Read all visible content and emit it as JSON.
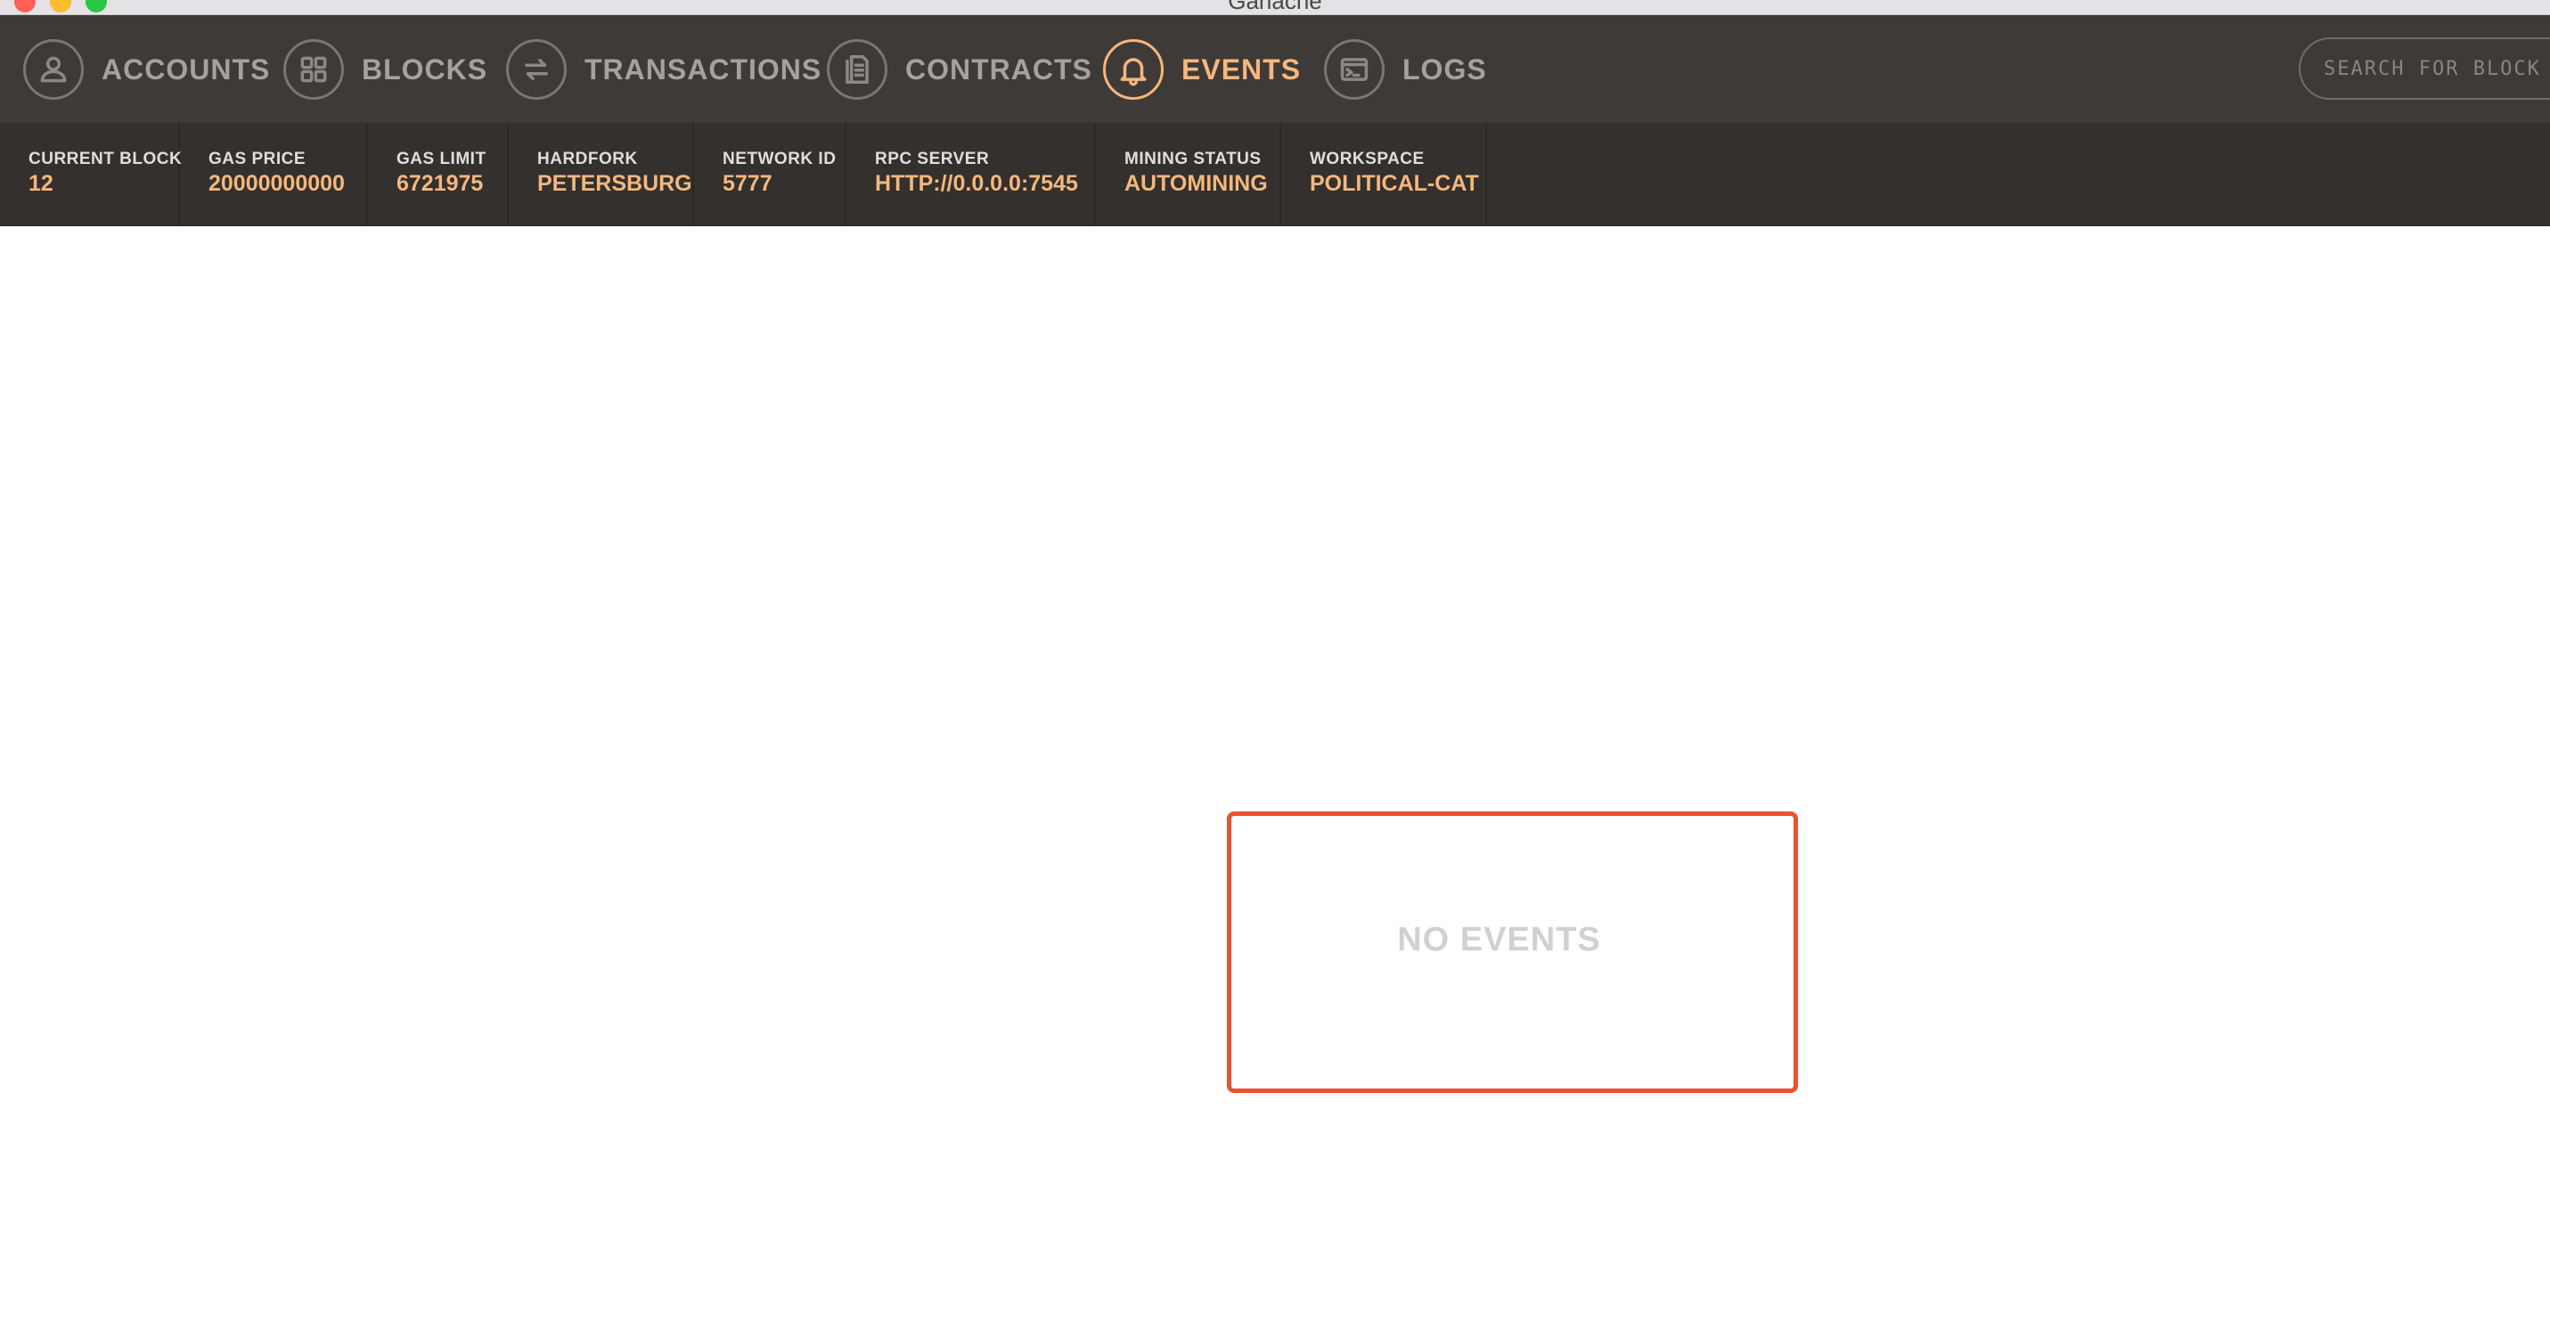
{
  "window": {
    "title": "Ganache"
  },
  "nav": {
    "items": [
      {
        "label": "ACCOUNTS",
        "icon": "user-icon",
        "active": false
      },
      {
        "label": "BLOCKS",
        "icon": "grid-icon",
        "active": false
      },
      {
        "label": "TRANSACTIONS",
        "icon": "arrows-icon",
        "active": false
      },
      {
        "label": "CONTRACTS",
        "icon": "document-icon",
        "active": false
      },
      {
        "label": "EVENTS",
        "icon": "bell-icon",
        "active": true
      },
      {
        "label": "LOGS",
        "icon": "terminal-icon",
        "active": false
      }
    ],
    "search_placeholder": "SEARCH FOR BLOCK NUMBERS OR TX HASHES"
  },
  "status": {
    "current_block": {
      "label": "CURRENT BLOCK",
      "value": "12"
    },
    "gas_price": {
      "label": "GAS PRICE",
      "value": "20000000000"
    },
    "gas_limit": {
      "label": "GAS LIMIT",
      "value": "6721975"
    },
    "hardfork": {
      "label": "HARDFORK",
      "value": "PETERSBURG"
    },
    "network_id": {
      "label": "NETWORK ID",
      "value": "5777"
    },
    "rpc_server": {
      "label": "RPC SERVER",
      "value": "HTTP://0.0.0.0:7545"
    },
    "mining_status": {
      "label": "MINING STATUS",
      "value": "AUTOMINING"
    },
    "workspace": {
      "label": "WORKSPACE",
      "value": "POLITICAL-CAT"
    }
  },
  "main": {
    "empty_message": "NO EVENTS"
  },
  "colors": {
    "nav_bg": "#3e3a38",
    "status_bg": "#33302e",
    "accent": "#f5b77c",
    "highlight_border": "#e8542c"
  }
}
